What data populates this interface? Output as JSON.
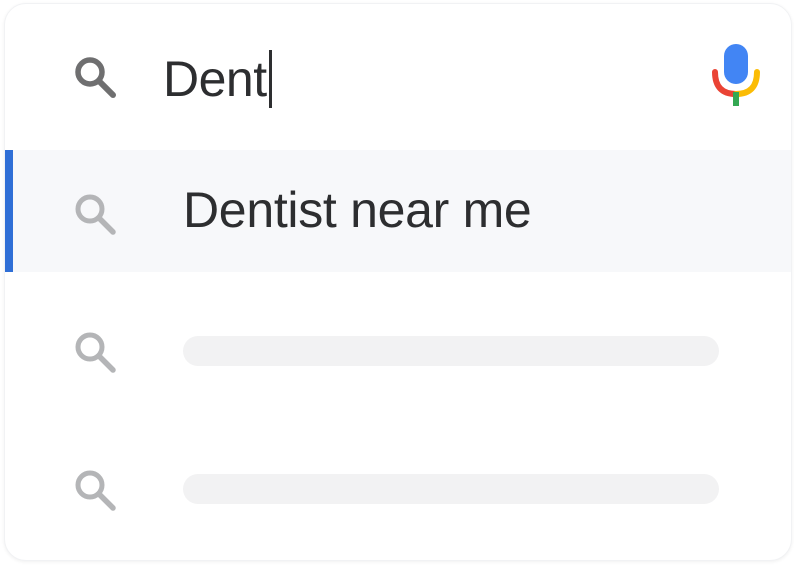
{
  "search": {
    "query": "Dent",
    "search_icon": "search-icon",
    "mic_icon": "microphone-icon",
    "mic_colors": {
      "body": "#4285f4",
      "left": "#ea4335",
      "right": "#fbbc05",
      "stand": "#34a853"
    }
  },
  "suggestions": [
    {
      "label": "Dentist near me",
      "icon": "search-icon",
      "selected": true
    },
    {
      "label": "",
      "icon": "search-icon",
      "selected": false,
      "loading": true
    },
    {
      "label": "",
      "icon": "search-icon",
      "selected": false,
      "loading": true
    }
  ],
  "colors": {
    "accent": "#2f6fd6",
    "text": "#2d2e30",
    "icon_primary": "#6f6f70",
    "icon_muted": "#b4b5b7",
    "placeholder": "#f2f2f3",
    "selected_bg": "#f7f8fa"
  }
}
